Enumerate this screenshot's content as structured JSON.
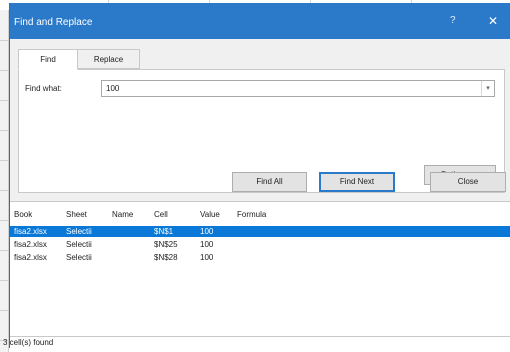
{
  "dialog": {
    "title": "Find and Replace",
    "help": "?",
    "close": "✕"
  },
  "tabs": [
    {
      "label": "Find",
      "active": true
    },
    {
      "label": "Replace",
      "active": false
    }
  ],
  "find": {
    "label": "Find what:",
    "value": "100"
  },
  "buttons": {
    "options": "Options >>",
    "find_all": "Find All",
    "find_next": "Find Next",
    "close": "Close"
  },
  "results": {
    "columns": [
      "Book",
      "Sheet",
      "Name",
      "Cell",
      "Value",
      "Formula"
    ],
    "rows": [
      {
        "book": "fisa2.xlsx",
        "sheet": "Selectii",
        "name": "",
        "cell": "$N$1",
        "value": "100",
        "formula": "",
        "selected": true
      },
      {
        "book": "fisa2.xlsx",
        "sheet": "Selectii",
        "name": "",
        "cell": "$N$25",
        "value": "100",
        "formula": "",
        "selected": false
      },
      {
        "book": "fisa2.xlsx",
        "sheet": "Selectii",
        "name": "",
        "cell": "$N$28",
        "value": "100",
        "formula": "",
        "selected": false
      }
    ]
  },
  "status": "3 cell(s) found",
  "colors": {
    "titlebar": "#2b79c9",
    "selection": "#0a78d7"
  }
}
